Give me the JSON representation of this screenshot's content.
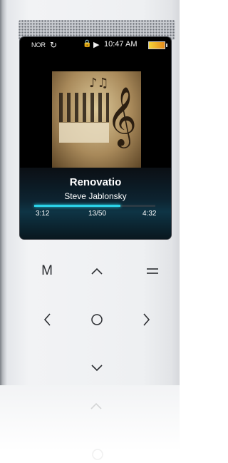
{
  "status": {
    "mode": "NOR",
    "time": "10:47 AM"
  },
  "now_playing": {
    "title": "Renovatio",
    "artist": "Steve Jablonsky",
    "elapsed": "3:12",
    "counter": "13/50",
    "total": "4:32",
    "progress": 0.71
  },
  "controls": {
    "menu_label": "M"
  },
  "icons": {
    "repeat": "repeat-icon",
    "lock": "lock-icon",
    "play": "play-icon",
    "battery": "battery-icon",
    "up": "chevron-up-icon",
    "down": "chevron-down-icon",
    "left": "chevron-left-icon",
    "right": "chevron-right-icon",
    "center": "circle-icon",
    "list": "list-icon"
  },
  "colors": {
    "accent": "#2bd3e8",
    "body": "#eef0f2",
    "screen": "#000000"
  }
}
